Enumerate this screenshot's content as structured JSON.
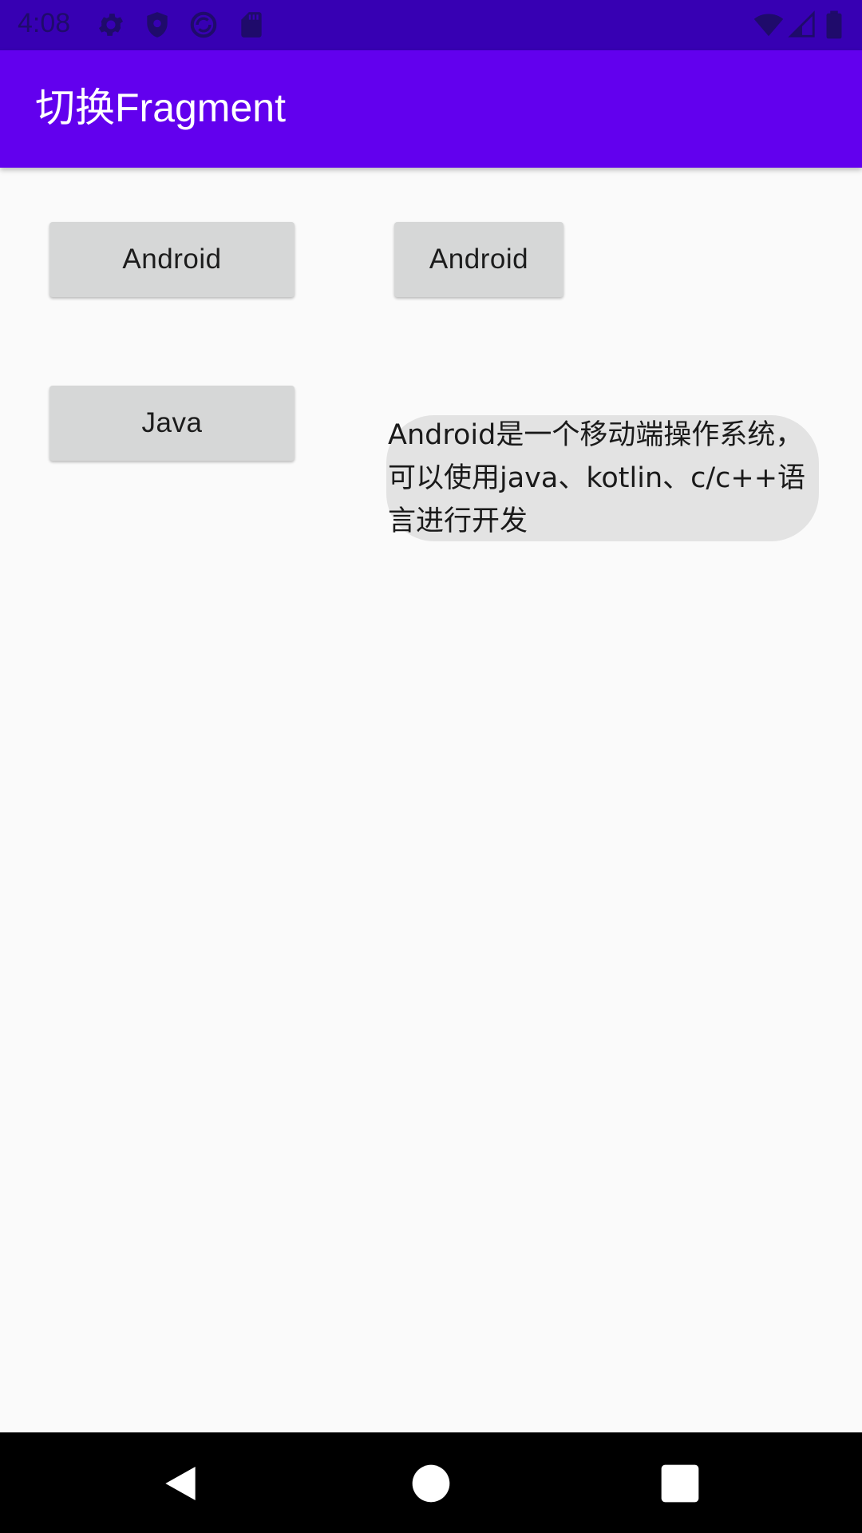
{
  "status_bar": {
    "time": "4:08",
    "icons_left": [
      "settings-icon",
      "shield-icon",
      "sync-icon",
      "sd-card-icon"
    ],
    "icons_right": [
      "wifi-icon",
      "signal-icon",
      "battery-icon"
    ],
    "background": "#3700b3"
  },
  "app_bar": {
    "title": "切换Fragment",
    "background": "#6200ee"
  },
  "buttons": {
    "android_1": "Android",
    "android_2": "Android",
    "java": "Java"
  },
  "content": {
    "description": "Android是一个移动端操作系统，可以使用java、kotlin、c/c++语言进行开发"
  },
  "nav_bar": {
    "icons": [
      "back-icon",
      "home-icon",
      "recents-icon"
    ]
  }
}
